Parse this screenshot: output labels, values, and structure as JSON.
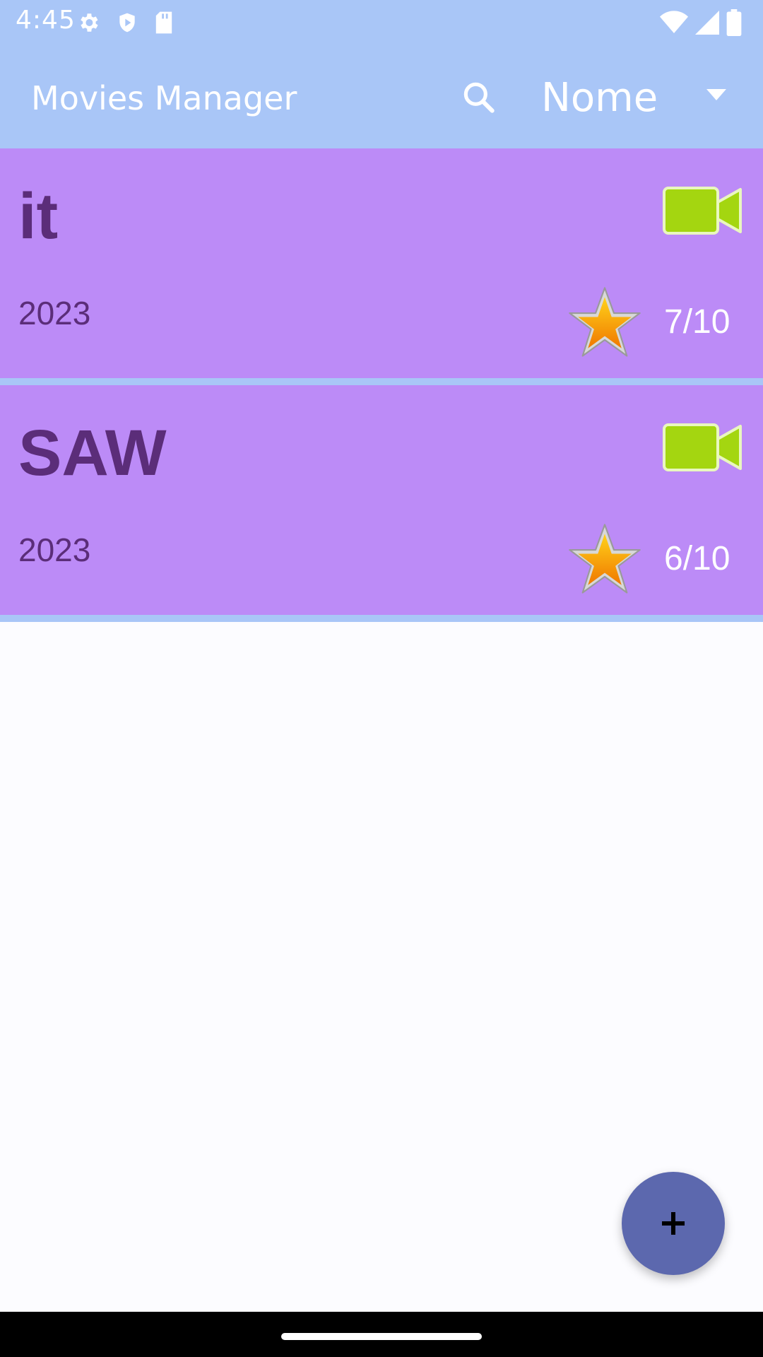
{
  "status_bar": {
    "time": "4:45",
    "left_icons": [
      "settings-icon",
      "shield-icon",
      "sd-card-icon"
    ],
    "right_icons": [
      "wifi-icon",
      "signal-icon",
      "battery-icon"
    ]
  },
  "app_bar": {
    "title": "Movies Manager",
    "search_icon": "search-icon",
    "sort": {
      "selected": "Nome"
    }
  },
  "movies": [
    {
      "title": "it",
      "year": "2023",
      "rating": "7/10"
    },
    {
      "title": "SAW",
      "year": "2023",
      "rating": "6/10"
    }
  ],
  "fab": {
    "icon": "plus-icon"
  },
  "colors": {
    "app_bar": "#a9c6f7",
    "card": "#bc8bf7",
    "card_text": "#5b2d79",
    "video_icon": "#a4d610",
    "fab": "#5c68ae",
    "background": "#fcfcff"
  }
}
